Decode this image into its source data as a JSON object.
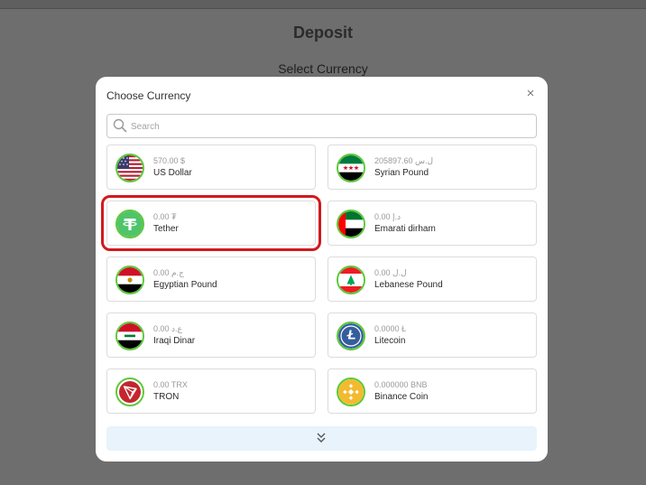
{
  "page": {
    "title": "Deposit",
    "subtitle": "Select Currency"
  },
  "modal": {
    "title": "Choose Currency",
    "close_label": "×",
    "search_placeholder": "Search",
    "currencies": [
      {
        "amount": "570.00 $",
        "name": "US Dollar",
        "icon": "us-flag-icon"
      },
      {
        "amount": "205897.60 ل.س",
        "name": "Syrian Pound",
        "icon": "syria-flag-icon"
      },
      {
        "amount": "0.00 ₮",
        "name": "Tether",
        "icon": "tether-icon",
        "highlighted": true
      },
      {
        "amount": "0.00 د.إ",
        "name": "Emarati dirham",
        "icon": "uae-flag-icon"
      },
      {
        "amount": "0.00 ج.م",
        "name": "Egyptian Pound",
        "icon": "egypt-flag-icon"
      },
      {
        "amount": "0.00 ل.ل",
        "name": "Lebanese Pound",
        "icon": "lebanon-flag-icon"
      },
      {
        "amount": "0.00 ع.د",
        "name": "Iraqi Dinar",
        "icon": "iraq-flag-icon"
      },
      {
        "amount": "0.0000 Ł",
        "name": "Litecoin",
        "icon": "litecoin-icon"
      },
      {
        "amount": "0.00 TRX",
        "name": "TRON",
        "icon": "tron-icon"
      },
      {
        "amount": "0.000000 BNB",
        "name": "Binance Coin",
        "icon": "bnb-icon"
      }
    ],
    "load_more_icon": "double-chevron-down-icon"
  },
  "colors": {
    "overlay": "#6e6e6e",
    "highlight": "#d2191c",
    "coin_ring": "#5cc93a",
    "load_more_bg": "#e8f3fb"
  }
}
